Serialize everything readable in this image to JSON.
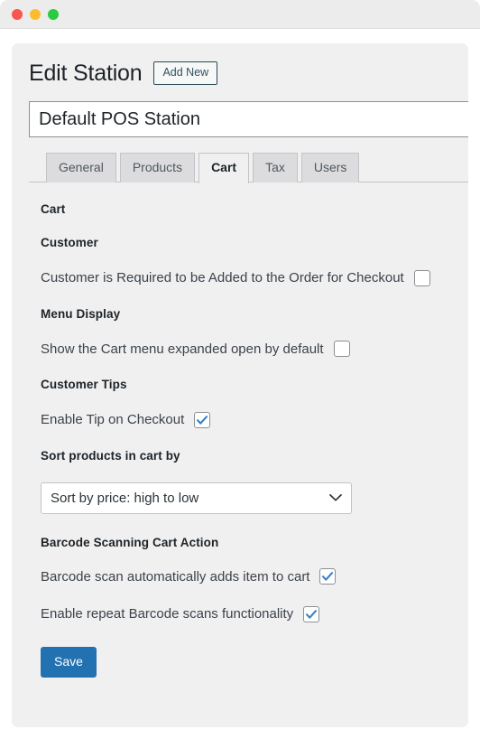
{
  "window": {
    "controls": [
      {
        "name": "close",
        "color": "#f9564f"
      },
      {
        "name": "minimize",
        "color": "#fbbd2e"
      },
      {
        "name": "zoom",
        "color": "#2acb41"
      }
    ]
  },
  "header": {
    "title": "Edit Station",
    "add_new_label": "Add New"
  },
  "station_name": {
    "value": "Default POS Station",
    "placeholder": "Station name"
  },
  "tabs": [
    {
      "label": "General",
      "active": false
    },
    {
      "label": "Products",
      "active": false
    },
    {
      "label": "Cart",
      "active": true
    },
    {
      "label": "Tax",
      "active": false
    },
    {
      "label": "Users",
      "active": false
    }
  ],
  "settings": {
    "panel_heading": "Cart",
    "sections": {
      "customer": {
        "heading": "Customer",
        "require_customer": {
          "label": "Customer is Required to be Added to the Order for Checkout",
          "checked": false
        }
      },
      "menu_display": {
        "heading": "Menu Display",
        "expand_cart_menu": {
          "label": "Show the Cart menu expanded open by default",
          "checked": false
        }
      },
      "customer_tips": {
        "heading": "Customer Tips",
        "enable_tip": {
          "label": "Enable Tip on Checkout",
          "checked": true
        }
      },
      "sort_products": {
        "heading": "Sort products in cart by",
        "selected": "Sort by price: high to low",
        "options": [
          "Sort by price: high to low"
        ]
      },
      "barcode": {
        "heading": "Barcode Scanning Cart Action",
        "auto_add": {
          "label": "Barcode scan automatically adds item to cart",
          "checked": true
        },
        "repeat_scans": {
          "label": "Enable repeat Barcode scans functionality",
          "checked": true
        }
      }
    },
    "save_label": "Save"
  },
  "colors": {
    "accent": "#2271b1",
    "card_bg": "#f0f0f1",
    "checkmark": "#3582c4",
    "text": "#3c434a",
    "heading": "#1d2327"
  }
}
